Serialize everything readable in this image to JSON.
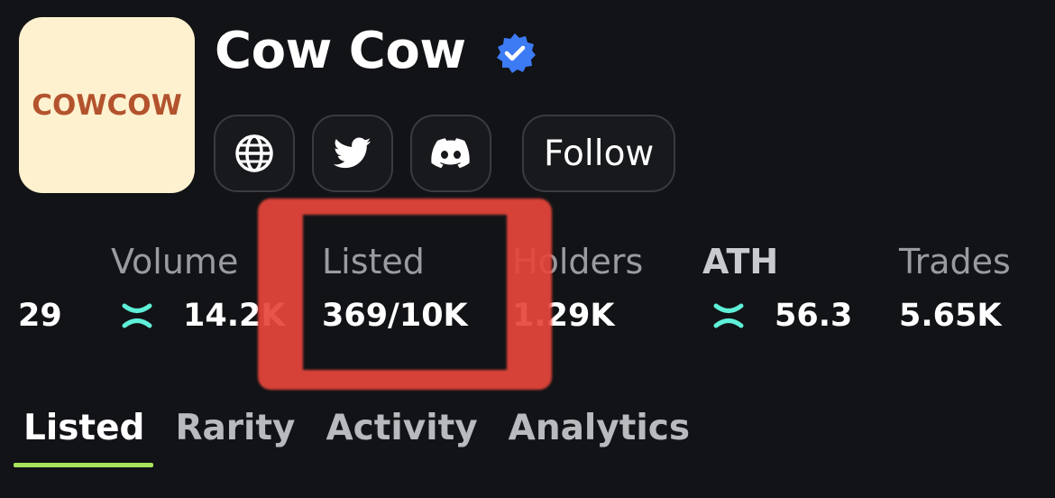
{
  "collection": {
    "logo_text": "COWCOW",
    "name": "Cow Cow",
    "verified": true
  },
  "buttons": {
    "website_icon": "globe-icon",
    "twitter_icon": "twitter-icon",
    "discord_icon": "discord-icon",
    "follow_label": "Follow"
  },
  "stats": {
    "partial_value": "29",
    "volume": {
      "label": "Volume",
      "value": "14.2K",
      "currency_icon": "x-token-icon"
    },
    "listed": {
      "label": "Listed",
      "value": "369/10K"
    },
    "holders": {
      "label": "Holders",
      "value": "1.29K"
    },
    "ath": {
      "label": "ATH",
      "value": "56.3",
      "currency_icon": "x-token-icon"
    },
    "trades": {
      "label": "Trades",
      "value": "5.65K"
    }
  },
  "tabs": [
    {
      "label": "Listed",
      "active": true
    },
    {
      "label": "Rarity",
      "active": false
    },
    {
      "label": "Activity",
      "active": false
    },
    {
      "label": "Analytics",
      "active": false
    }
  ],
  "colors": {
    "background": "#121316",
    "accent_green": "#a8e55c",
    "verified_blue": "#3d7bf5",
    "token_teal": "#5ef0d8",
    "highlight_red": "#e8463b",
    "logo_bg": "#fdf1cf",
    "logo_text": "#b3532e"
  }
}
